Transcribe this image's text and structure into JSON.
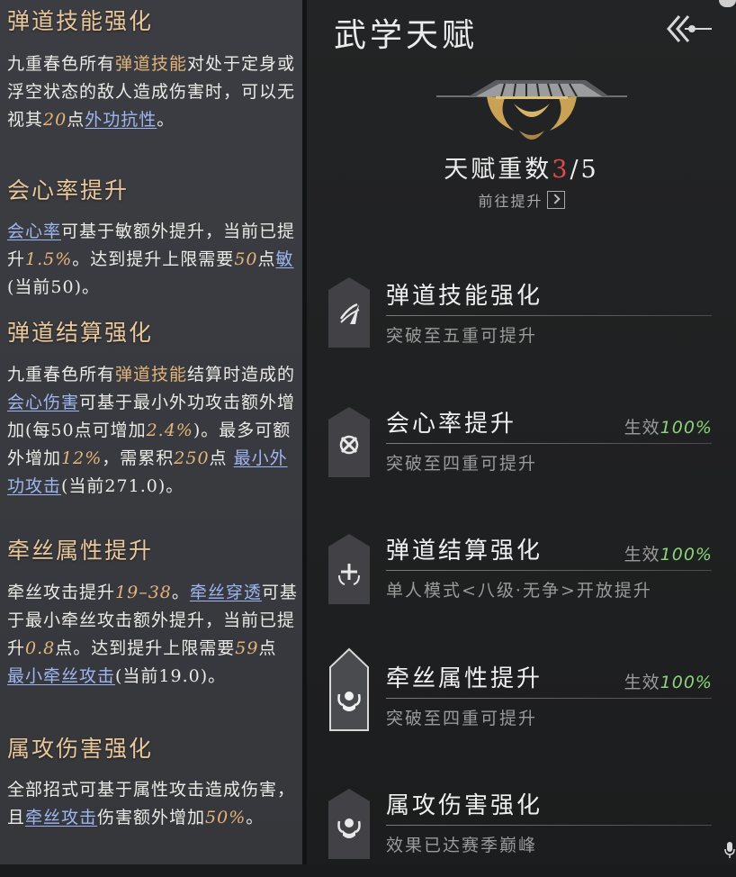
{
  "left": {
    "sections": [
      {
        "title": "弹道技能强化",
        "body": [
          {
            "t": "九重春色所有"
          },
          {
            "t": "弹道技能",
            "s": "hl"
          },
          {
            "t": "对处于定身或浮空状态的敌人造成伤害时，可以无视其"
          },
          {
            "t": "20",
            "s": "num"
          },
          {
            "t": "点"
          },
          {
            "t": "外功抗性",
            "s": "ul"
          },
          {
            "t": "。"
          }
        ]
      },
      {
        "title": "会心率提升",
        "body": [
          {
            "t": "会心率",
            "s": "ul"
          },
          {
            "t": "可基于敏额外提升，当前已提升"
          },
          {
            "t": "1.5%",
            "s": "num"
          },
          {
            "t": "。达到提升上限需要"
          },
          {
            "t": "50",
            "s": "num"
          },
          {
            "t": "点"
          },
          {
            "t": "敏",
            "s": "ul"
          },
          {
            "t": "(当前50)。"
          }
        ]
      },
      {
        "title": "弹道结算强化",
        "body": [
          {
            "t": "九重春色所有"
          },
          {
            "t": "弹道技能",
            "s": "hl"
          },
          {
            "t": "结算时造成的"
          },
          {
            "t": "会心伤害",
            "s": "ul"
          },
          {
            "t": "可基于最小外功攻击额外增加(每50点可增加"
          },
          {
            "t": "2.4%",
            "s": "num"
          },
          {
            "t": ")。最多可额外增加"
          },
          {
            "t": "12%",
            "s": "num"
          },
          {
            "t": "，需累积"
          },
          {
            "t": "250",
            "s": "num"
          },
          {
            "t": "点 "
          },
          {
            "t": "最小外功攻击",
            "s": "ul"
          },
          {
            "t": "(当前271.0)。"
          }
        ]
      },
      {
        "title": "牵丝属性提升",
        "body": [
          {
            "t": "牵丝攻击提升"
          },
          {
            "t": "19–38",
            "s": "num"
          },
          {
            "t": "。"
          },
          {
            "t": "牵丝穿透",
            "s": "ul"
          },
          {
            "t": "可基于最小牵丝攻击额外提升，当前已提升"
          },
          {
            "t": "0.8",
            "s": "num"
          },
          {
            "t": "点。达到提升上限需要"
          },
          {
            "t": "59",
            "s": "num"
          },
          {
            "t": "点 "
          },
          {
            "t": "最小牵丝攻击",
            "s": "ul"
          },
          {
            "t": "(当前19.0)。"
          }
        ]
      },
      {
        "title": "属攻伤害强化",
        "body": [
          {
            "t": "全部招式可基于属性攻击造成伤害，且"
          },
          {
            "t": "牵丝攻击",
            "s": "ul"
          },
          {
            "t": "伤害额外增加"
          },
          {
            "t": "50%",
            "s": "num"
          },
          {
            "t": "。"
          }
        ]
      }
    ]
  },
  "right": {
    "title": "武学天赋",
    "rank_label": "天赋重数",
    "rank_current": "3",
    "rank_sep": "/",
    "rank_max": "5",
    "goto_label": "前往提升",
    "status_prefix": "生效",
    "talents": [
      {
        "name": "弹道技能强化",
        "desc": "突破至五重可提升",
        "status": "",
        "icon": "blade-swipe-icon",
        "active": false
      },
      {
        "name": "会心率提升",
        "desc": "突破至四重可提升",
        "status": "100%",
        "icon": "crosshair-icon",
        "active": false
      },
      {
        "name": "弹道结算强化",
        "desc": "单人模式<八级·无争>开放提升",
        "status": "100%",
        "icon": "plus-target-icon",
        "active": false
      },
      {
        "name": "牵丝属性提升",
        "desc": "突破至四重可提升",
        "status": "100%",
        "icon": "fist-icon",
        "active": true
      },
      {
        "name": "属攻伤害强化",
        "desc": "效果已达赛季巅峰",
        "status": "",
        "icon": "fist-icon",
        "active": false
      }
    ]
  },
  "colors": {
    "accent_gold": "#e0b37a",
    "link_blue": "#9fb6f0",
    "rank_red": "#e24a4a",
    "active_green": "#8bd47a"
  }
}
